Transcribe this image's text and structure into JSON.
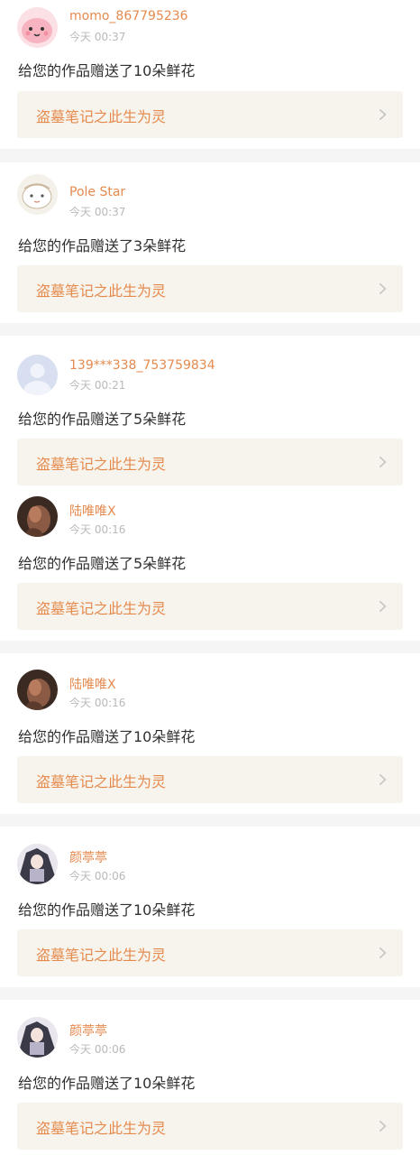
{
  "items": [
    {
      "username": "momo_867795236",
      "time": "今天 00:37",
      "message": "给您的作品赠送了10朵鲜花",
      "work_title": "盗墓笔记之此生为灵",
      "avatar": "pink-blob-avatar"
    },
    {
      "username": "Pole Star",
      "time": "今天 00:37",
      "message": "给您的作品赠送了3朵鲜花",
      "work_title": "盗墓笔记之此生为灵",
      "avatar": "cartoon-face-avatar"
    },
    {
      "username": "139***338_753759834",
      "time": "今天 00:21",
      "message": "给您的作品赠送了5朵鲜花",
      "work_title": "盗墓笔记之此生为灵",
      "avatar": "default-person-avatar"
    },
    {
      "username": "陆唯唯X",
      "time": "今天 00:16",
      "message": "给您的作品赠送了5朵鲜花",
      "work_title": "盗墓笔记之此生为灵",
      "avatar": "photo-avatar"
    },
    {
      "username": "陆唯唯X",
      "time": "今天 00:16",
      "message": "给您的作品赠送了10朵鲜花",
      "work_title": "盗墓笔记之此生为灵",
      "avatar": "photo-avatar"
    },
    {
      "username": "颜葶葶",
      "time": "今天 00:06",
      "message": "给您的作品赠送了10朵鲜花",
      "work_title": "盗墓笔记之此生为灵",
      "avatar": "character-avatar"
    },
    {
      "username": "颜葶葶",
      "time": "今天 00:06",
      "message": "给您的作品赠送了10朵鲜花",
      "work_title": "盗墓笔记之此生为灵",
      "avatar": "character-avatar"
    }
  ],
  "colors": {
    "accent": "#e58a4e",
    "card_bg": "#f6f4ec",
    "text": "#2f2f2f",
    "muted": "#b9b9b9",
    "separator": "#f5f5f5"
  }
}
